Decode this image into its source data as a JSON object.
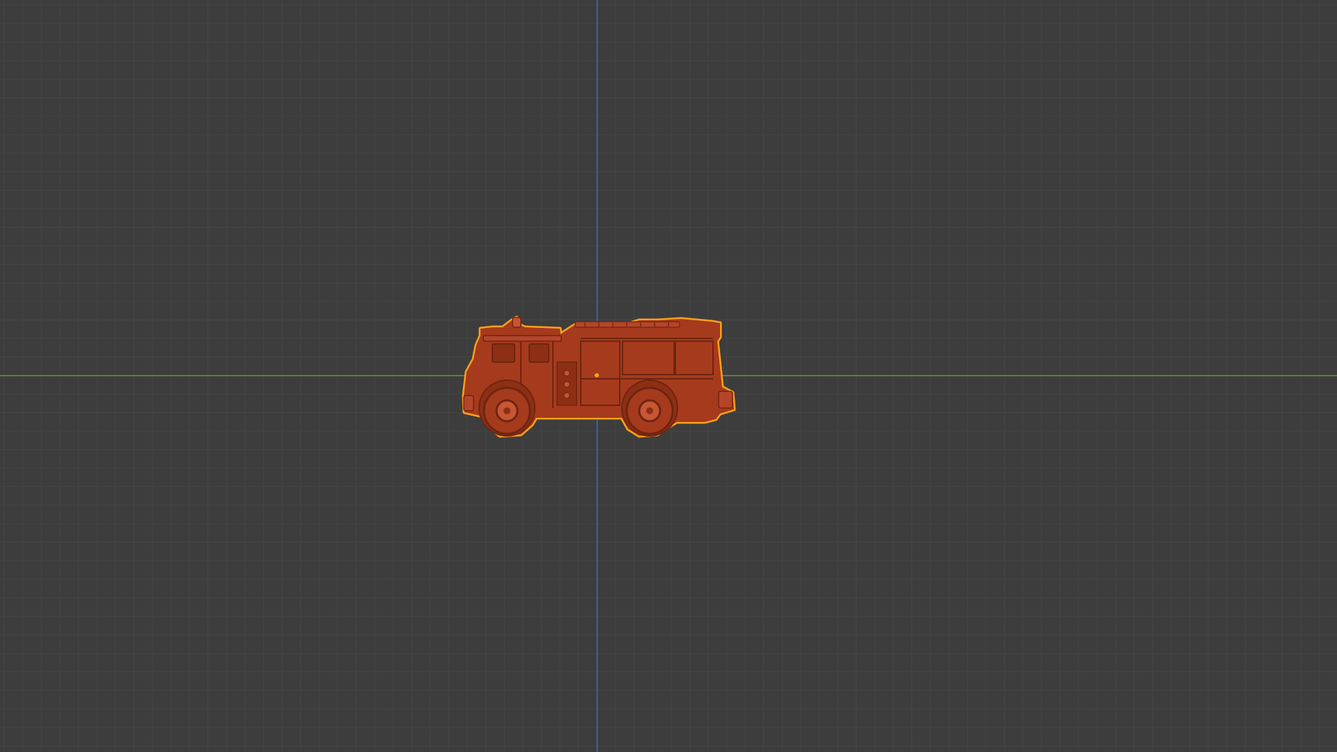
{
  "viewport": {
    "background_color": "#3d3d3d",
    "grid_minor_color": "#4a4a4a",
    "grid_major_color": "#535353",
    "x_axis_color": "#6a9a2e",
    "y_axis_color": "#2f72c0",
    "grid_visible": true
  },
  "object": {
    "name_icon": "fire-truck-mesh",
    "base_color": "#a63a1c",
    "shadow_color": "#6e2510",
    "highlight_color": "#c65634",
    "outline_color": "#ffa11a",
    "selected": true
  }
}
